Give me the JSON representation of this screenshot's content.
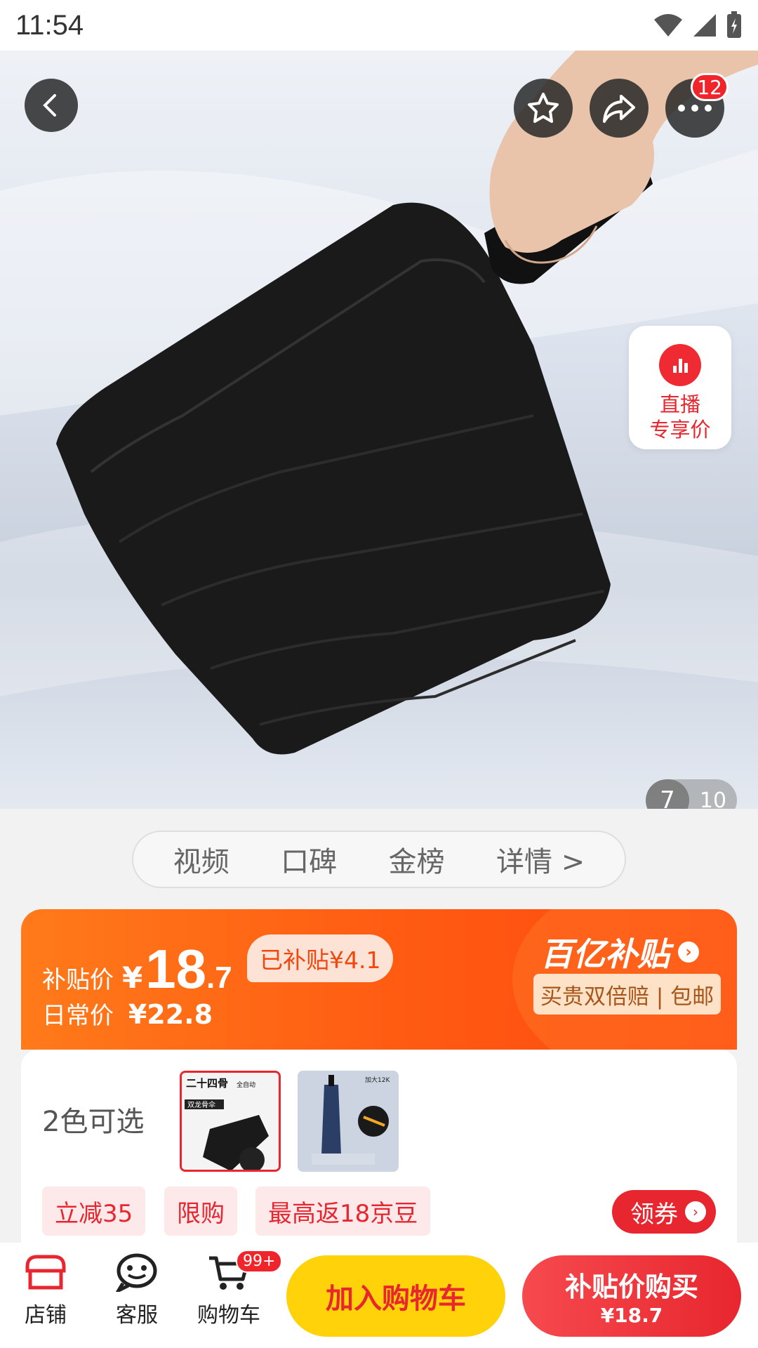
{
  "status_bar": {
    "time": "11:54"
  },
  "header": {
    "more_badge": "12"
  },
  "live": {
    "line1": "直播",
    "line2": "专享价"
  },
  "gallery": {
    "current": "7",
    "total": "10"
  },
  "tabs": [
    "视频",
    "口碑",
    "金榜",
    "详情 >"
  ],
  "price": {
    "label": "补贴价",
    "yen": "¥",
    "integer": "18",
    "decimal": ".7",
    "subsidized": "已补贴¥4.1",
    "regular_label": "日常价",
    "regular_price": "¥22.8",
    "brand": "百亿补贴",
    "promise": "买贵双倍赔 | 包邮"
  },
  "variants": {
    "label": "2色可选",
    "thumb1_lines": [
      "二十四骨",
      "全自动",
      "双龙骨伞"
    ],
    "thumb2_lines": [
      "加大12K"
    ]
  },
  "promos": [
    "立减35",
    "限购",
    "最高返18京豆"
  ],
  "coupon": "领券",
  "bottom": {
    "shop": "店铺",
    "service": "客服",
    "cart": "购物车",
    "cart_badge": "99+",
    "add_to_cart": "加入购物车",
    "buy_line1": "补贴价购买",
    "buy_line2": "¥18.7"
  }
}
